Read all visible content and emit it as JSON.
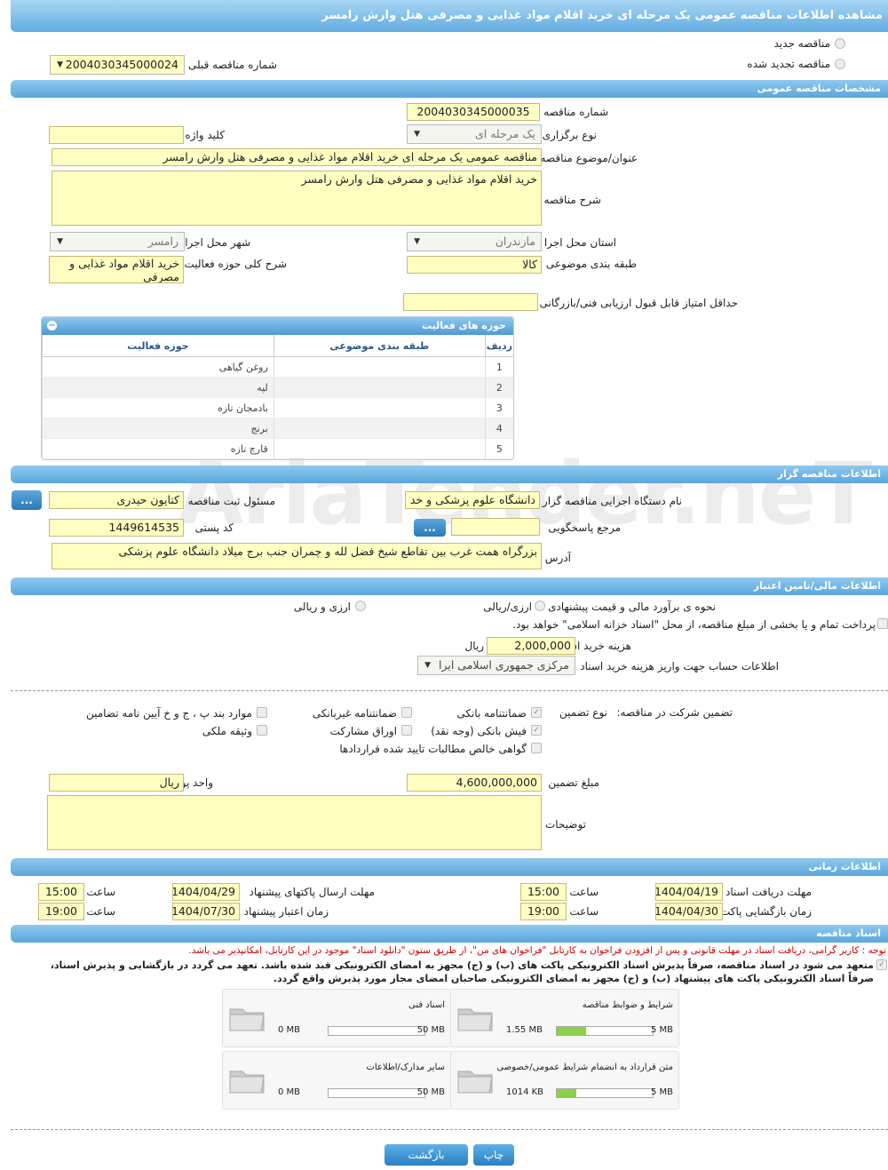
{
  "title": "مشاهده اطلاعات مناقصه عمومی یک مرحله ای خرید اقلام مواد غذایی و مصرفی هتل وارش رامسر",
  "top": {
    "new_tender": "مناقصه جدید",
    "renewed_tender": "مناقصه تجدید شده",
    "prev_number_label": "شماره مناقصه قبلی",
    "prev_number_value": "2004030345000024"
  },
  "general": {
    "section_title": "مشخصات مناقصه عمومی",
    "number_label": "شماره مناقصه",
    "number_value": "2004030345000035",
    "type_label": "نوع برگزاری",
    "type_value": "یک مرحله ای",
    "keyword_label": "کلید واژه",
    "keyword_value": "",
    "subject_label": "عنوان/موضوع مناقصه",
    "subject_value": "مناقصه عمومی یک مرحله ای خرید اقلام مواد غذایی و مصرفی هتل وارش رامسر",
    "desc_label": "شرح مناقصه",
    "desc_value": "خرید اقلام مواد غذایی و مصرفی هتل وارش رامسر",
    "province_label": "استان محل اجرا",
    "province_value": "مازندران",
    "city_label": "شهر محل اجرا",
    "city_value": "رامسر",
    "category_label": "طبقه بندی موضوعی",
    "category_value": "کالا",
    "activity_desc_label": "شرح کلی حوزه فعالیت",
    "activity_desc_value": "خرید اقلام مواد غذایی و مصرفی",
    "min_score_label": "حداقل امتیاز قابل قبول ارزیابی فنی/بازرگانی",
    "min_score_value": ""
  },
  "activities": {
    "title": "حوزه های فعالیت",
    "col_row": "ردیف",
    "col_category": "طبقه بندی موضوعی",
    "col_field": "حوزه فعالیت",
    "rows": [
      {
        "n": "1",
        "cat": "",
        "field": "روغن گیاهی"
      },
      {
        "n": "2",
        "cat": "",
        "field": "لپه"
      },
      {
        "n": "3",
        "cat": "",
        "field": "بادمجان تازه"
      },
      {
        "n": "4",
        "cat": "",
        "field": "برنج"
      },
      {
        "n": "5",
        "cat": "",
        "field": "قارچ تازه"
      }
    ]
  },
  "organizer": {
    "section_title": "اطلاعات مناقصه گزار",
    "org_label": "نام دستگاه اجرایی مناقصه گزار",
    "org_value": "دانشگاه علوم پزشکی و خد",
    "registrar_label": "مسئول ثبت مناقصه",
    "registrar_value": "کتایون حیدری",
    "ref_label": "مرجع پاسخگویی",
    "ref_value": "",
    "postal_label": "کد پستی",
    "postal_value": "1449614535",
    "address_label": "آدرس",
    "address_value": "بزرگراه همت غرب بین تقاطع شیخ فضل لله و چمران جنب برج میلاد دانشگاه علوم پزشکی",
    "dots": "..."
  },
  "finance": {
    "section_title": "اطلاعات مالی/تامین اعتبار",
    "estimate_label": "نحوه ی برآورد مالی و قیمت پیشنهادی",
    "opt_rial": "ارزی/ریالی",
    "opt_both": "ارزی و ریالی",
    "treasury_text": "پرداخت تمام و یا بخشی از مبلغ مناقصه، از محل \"اسناد خزانه اسلامی\" خواهد بود.",
    "purchase_fee_label": "هزینه خرید اسناد",
    "purchase_fee_value": "2,000,000",
    "rial": "ریال",
    "account_label": "اطلاعات حساب جهت واریز هزینه خرید اسناد",
    "account_value": "مرکزی جمهوری اسلامی ایرا"
  },
  "guarantee": {
    "participation_label": "تضمین شرکت در مناقصه:",
    "type_label": "نوع تضمین",
    "bank_guarantee": "ضمانتنامه بانکی",
    "nonbank_guarantee": "ضمانتنامه غیربانکی",
    "clause_items": "موارد بند پ ، ج و خ آیین نامه تضامین",
    "bank_receipt": "فیش بانکی (وجه نقد)",
    "bonds": "اوراق مشارکت",
    "property": "وثیقه ملکی",
    "net_claims": "گواهی خالص مطالبات تایید شده قراردادها",
    "amount_label": "مبلغ تضمین",
    "amount_value": "4,600,000,000",
    "currency_label": "واحد پول",
    "currency_value": "ریال",
    "notes_label": "توضیحات",
    "notes_value": ""
  },
  "timing": {
    "section_title": "اطلاعات زمانی",
    "receive_label": "مهلت دریافت اسناد",
    "receive_date": "1404/04/19",
    "receive_time": "15:00",
    "send_label": "مهلت ارسال پاکتهای پیشنهاد",
    "send_date": "1404/04/29",
    "send_time": "15:00",
    "open_label": "زمان بازگشایی پاکت ها",
    "open_date": "1404/04/30",
    "open_time": "19:00",
    "validity_label": "زمان اعتبار پیشنهاد",
    "validity_date": "1404/07/30",
    "validity_time": "19:00",
    "time_label": "ساعت"
  },
  "docs": {
    "section_title": "اسناد مناقصه",
    "notice": "توجه : کاربر گرامی، دریافت اسناد در مهلت قانونی و پس از افزودن فراخوان به کارتابل \"فراخوان های من\"، از طریق ستون \"دانلود اسناد\" موجود در این کارتابل، امکانپذیر می باشد.",
    "commitment_1": "متعهد می شود در اسناد مناقصه، صرفاً پذیرش اسناد الکترونیکی پاکت های (ب) و (ج) مجهز به امضای الکترونیکی قبد شده باشد. تعهد می گردد در بازگشایی و پذیرش اسناد،",
    "commitment_2": "صرفاً اسناد الکترونیکی پاکت های پیشنهاد (ب) و (ج) مجهز به امضای الکترونیکی صاحبان امضای مجاز مورد پذیرش واقع گردد.",
    "cards": [
      {
        "name": "شرایط و ضوابط مناقصه",
        "used": "1.55 MB",
        "max": "5 MB",
        "progress": 0.31
      },
      {
        "name": "اسناد فنی",
        "used": "0 MB",
        "max": "50 MB",
        "progress": 0
      },
      {
        "name": "متن قرارداد به انضمام شرایط عمومی/خصوصی",
        "used": "1014 KB",
        "max": "5 MB",
        "progress": 0.2
      },
      {
        "name": "سایر مدارک/اطلاعات",
        "used": "0 MB",
        "max": "50 MB",
        "progress": 0
      }
    ]
  },
  "buttons": {
    "print": "چاپ",
    "back": "بازگشت"
  },
  "watermark": "AriaTender.neT",
  "colors": {
    "bar_blue": "#5aa7dc",
    "field_yellow": "#ffffc1",
    "progress_green": "#8cd04b",
    "notice_red": "#cc0000"
  }
}
